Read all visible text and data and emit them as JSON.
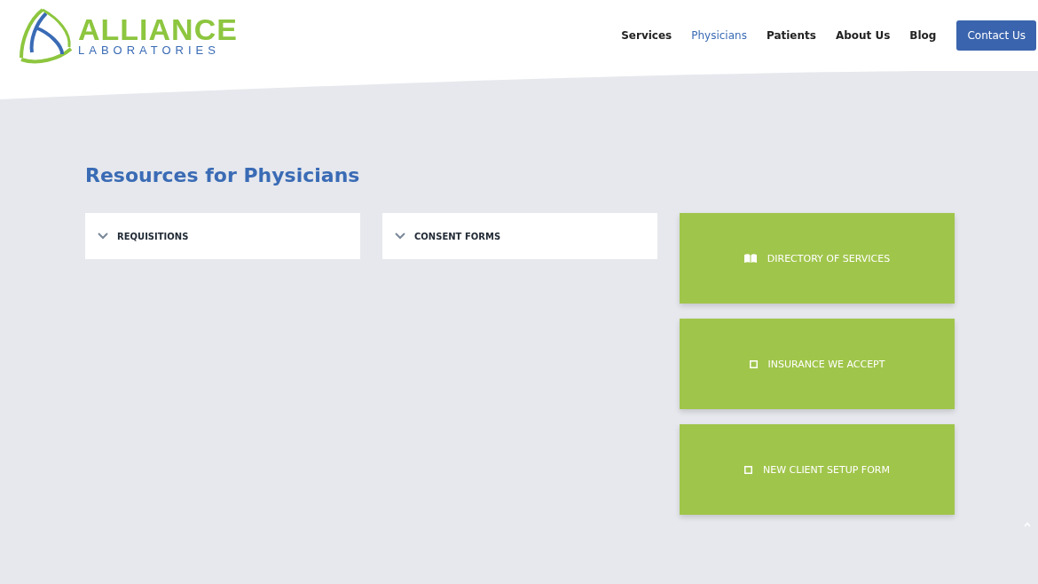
{
  "logo": {
    "name": "ALLIANCE",
    "subtitle": "LABORATORIES"
  },
  "nav": [
    {
      "label": "Services",
      "selected": false
    },
    {
      "label": "Physicians",
      "selected": true
    },
    {
      "label": "Patients",
      "selected": false
    },
    {
      "label": "About Us",
      "selected": false
    },
    {
      "label": "Blog",
      "selected": false
    }
  ],
  "contact_button": "Contact Us",
  "heading": "Resources for Physicians",
  "accordions": [
    {
      "label": "REQUISITIONS",
      "expanded": false
    },
    {
      "label": "CONSENT FORMS",
      "expanded": false
    }
  ],
  "resource_buttons": [
    {
      "label": "DIRECTORY OF SERVICES",
      "kind": "book"
    },
    {
      "label": "INSURANCE WE ACCEPT",
      "kind": "square"
    },
    {
      "label": "NEW CLIENT SETUP FORM",
      "kind": "square"
    }
  ]
}
